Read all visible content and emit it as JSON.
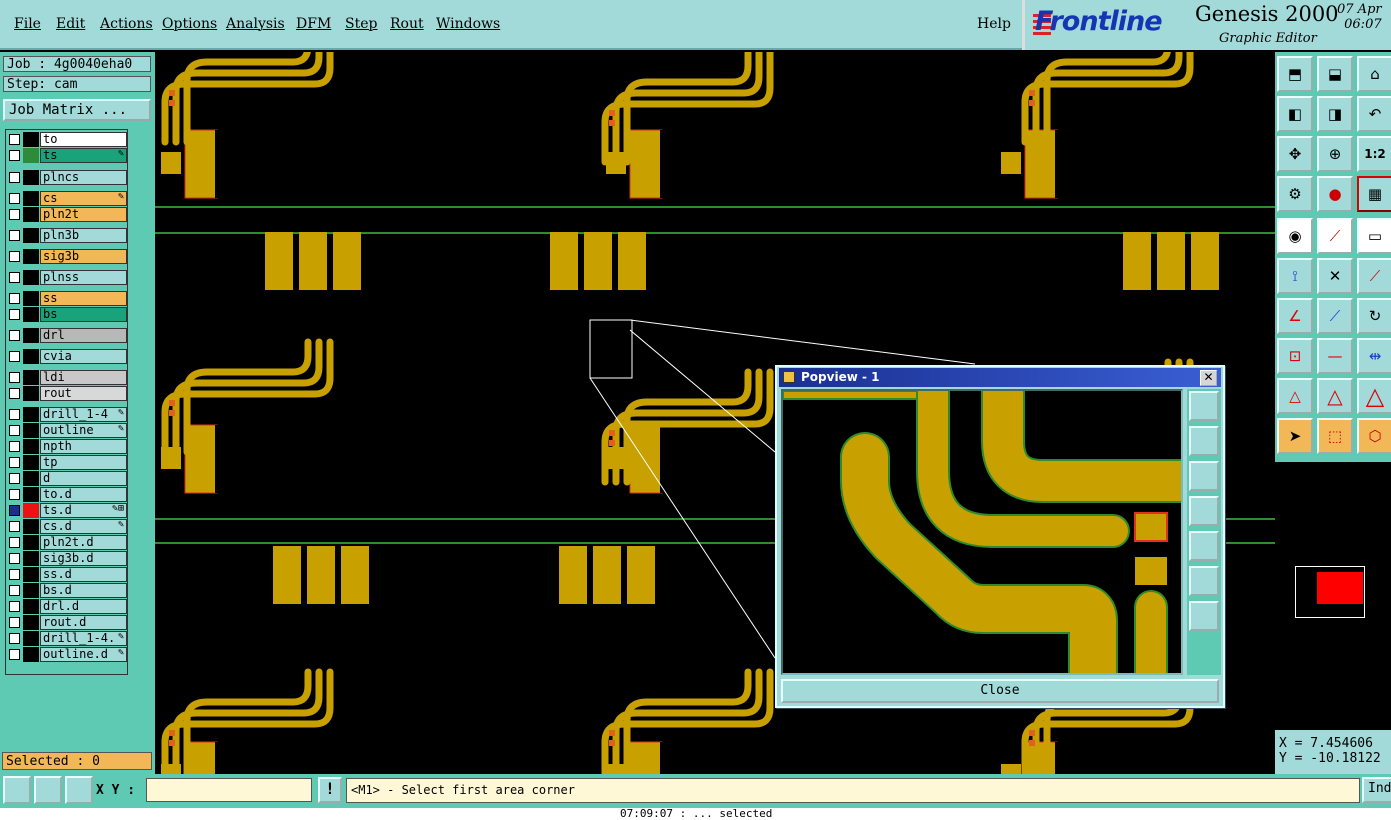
{
  "menu": {
    "items": [
      "File",
      "Edit",
      "Actions",
      "Options",
      "Analysis",
      "DFM",
      "Step",
      "Rout",
      "Windows"
    ],
    "help": "Help"
  },
  "brand": {
    "logo": "Frontline",
    "title": "Genesis 2000",
    "subtitle": "Graphic Editor",
    "date": "07 Apr",
    "time": "06:07"
  },
  "job": {
    "job_label": "Job : 4g0040eha0",
    "step_label": "Step: cam",
    "matrix_button": "Job Matrix ..."
  },
  "layers": [
    {
      "name": "to",
      "color": "#ffffff",
      "swatch": "#000000",
      "flag": ""
    },
    {
      "name": "ts",
      "color": "#1aa37a",
      "swatch": "#2e8b3a",
      "flag": "✎"
    },
    {
      "name": "plncs",
      "color": "#a2d9d9",
      "swatch": "#000000",
      "flag": ""
    },
    {
      "name": "cs",
      "color": "#f2b756",
      "swatch": "#000000",
      "flag": "✎"
    },
    {
      "name": "pln2t",
      "color": "#f2b756",
      "swatch": "#000000",
      "flag": ""
    },
    {
      "name": "pln3b",
      "color": "#a2d9d9",
      "swatch": "#000000",
      "flag": ""
    },
    {
      "name": "sig3b",
      "color": "#f2b756",
      "swatch": "#000000",
      "flag": ""
    },
    {
      "name": "plnss",
      "color": "#a2d9d9",
      "swatch": "#000000",
      "flag": ""
    },
    {
      "name": "ss",
      "color": "#f2b756",
      "swatch": "#000000",
      "flag": ""
    },
    {
      "name": "bs",
      "color": "#1aa37a",
      "swatch": "#000000",
      "flag": ""
    },
    {
      "name": "drl",
      "color": "#b8b8b8",
      "swatch": "#000000",
      "flag": ""
    },
    {
      "name": "cvia",
      "color": "#a2d9d9",
      "swatch": "#000000",
      "flag": ""
    },
    {
      "name": "ldi",
      "color": "#c8c8c8",
      "swatch": "#000000",
      "flag": ""
    },
    {
      "name": "rout",
      "color": "#d8d8d8",
      "swatch": "#000000",
      "flag": ""
    },
    {
      "name": "drill_1-4",
      "color": "#a2d9d9",
      "swatch": "#000000",
      "flag": "✎"
    },
    {
      "name": "outline",
      "color": "#a2d9d9",
      "swatch": "#000000",
      "flag": "✎"
    },
    {
      "name": "npth",
      "color": "#a2d9d9",
      "swatch": "#000000",
      "flag": ""
    },
    {
      "name": "tp",
      "color": "#a2d9d9",
      "swatch": "#000000",
      "flag": ""
    },
    {
      "name": "d",
      "color": "#a2d9d9",
      "swatch": "#000000",
      "flag": ""
    },
    {
      "name": "to.d",
      "color": "#a2d9d9",
      "swatch": "#000000",
      "flag": ""
    },
    {
      "name": "ts.d",
      "color": "#a2d9d9",
      "swatch": "#ee1111",
      "flag": "✎⊞"
    },
    {
      "name": "cs.d",
      "color": "#a2d9d9",
      "swatch": "#000000",
      "flag": "✎"
    },
    {
      "name": "pln2t.d",
      "color": "#a2d9d9",
      "swatch": "#000000",
      "flag": ""
    },
    {
      "name": "sig3b.d",
      "color": "#a2d9d9",
      "swatch": "#000000",
      "flag": ""
    },
    {
      "name": "ss.d",
      "color": "#a2d9d9",
      "swatch": "#000000",
      "flag": ""
    },
    {
      "name": "bs.d",
      "color": "#a2d9d9",
      "swatch": "#000000",
      "flag": ""
    },
    {
      "name": "drl.d",
      "color": "#a2d9d9",
      "swatch": "#000000",
      "flag": ""
    },
    {
      "name": "rout.d",
      "color": "#a2d9d9",
      "swatch": "#000000",
      "flag": ""
    },
    {
      "name": "drill_1-4.",
      "color": "#a2d9d9",
      "swatch": "#000000",
      "flag": "✎"
    },
    {
      "name": "outline.d",
      "color": "#a2d9d9",
      "swatch": "#000000",
      "flag": "✎"
    }
  ],
  "selected": "Selected : 0",
  "status": {
    "xy_label": "X Y :",
    "xy_value": "",
    "prompt": "<M1> - Select first area corner",
    "ind_label": "Ind",
    "bottom_text": "07:09:07 :  ... selected"
  },
  "coords": {
    "x": "X = 7.454606",
    "y": "Y = -10.18122"
  },
  "popview": {
    "title": "Popview - 1",
    "close_label": "Close"
  },
  "colors": {
    "copper": "#c8a000",
    "trace_outline": "#2e8b2e",
    "pad_outline": "#e03020",
    "panel_teal": "#5ecab3",
    "menu_bg": "#a2d9d9"
  }
}
